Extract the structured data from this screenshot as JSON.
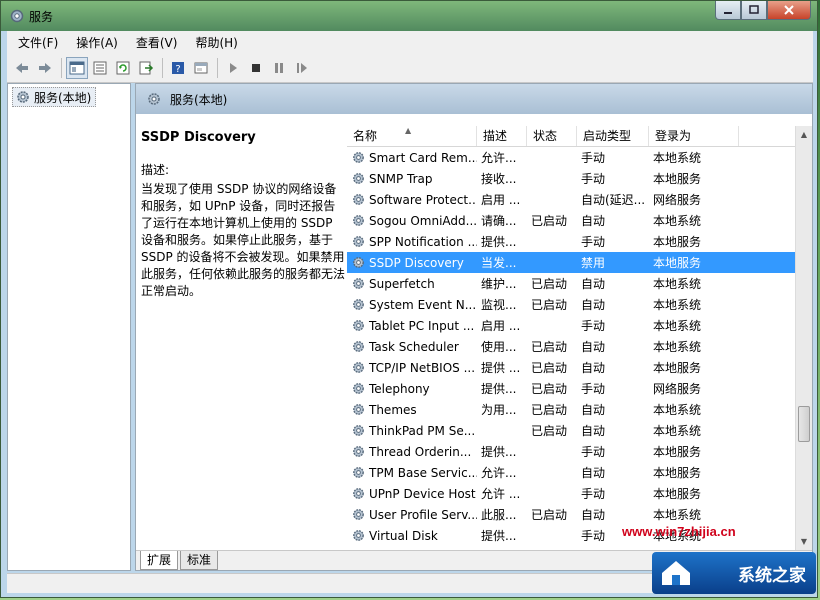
{
  "window": {
    "title": "服务"
  },
  "menu": [
    "文件(F)",
    "操作(A)",
    "查看(V)",
    "帮助(H)"
  ],
  "tree": {
    "root": "服务(本地)"
  },
  "main": {
    "header": "服务(本地)",
    "selected_service": {
      "title": "SSDP Discovery",
      "desc_label": "描述:",
      "desc": "当发现了使用 SSDP 协议的网络设备和服务，如 UPnP 设备，同时还报告了运行在本地计算机上使用的 SSDP 设备和服务。如果停止此服务，基于 SSDP 的设备将不会被发现。如果禁用此服务，任何依赖此服务的服务都无法正常启动。"
    },
    "columns": [
      "名称",
      "描述",
      "状态",
      "启动类型",
      "登录为"
    ],
    "sort_arrow": "▲",
    "rows": [
      {
        "name": "Smart Card Rem...",
        "desc": "允许...",
        "status": "",
        "startup": "手动",
        "logon": "本地系统"
      },
      {
        "name": "SNMP Trap",
        "desc": "接收...",
        "status": "",
        "startup": "手动",
        "logon": "本地服务"
      },
      {
        "name": "Software Protect...",
        "desc": "启用 ...",
        "status": "",
        "startup": "自动(延迟...",
        "logon": "网络服务"
      },
      {
        "name": "Sogou OmniAdd...",
        "desc": "请确...",
        "status": "已启动",
        "startup": "自动",
        "logon": "本地系统"
      },
      {
        "name": "SPP Notification ...",
        "desc": "提供...",
        "status": "",
        "startup": "手动",
        "logon": "本地服务"
      },
      {
        "name": "SSDP Discovery",
        "desc": "当发...",
        "status": "",
        "startup": "禁用",
        "logon": "本地服务",
        "selected": true
      },
      {
        "name": "Superfetch",
        "desc": "维护...",
        "status": "已启动",
        "startup": "自动",
        "logon": "本地系统"
      },
      {
        "name": "System Event N...",
        "desc": "监视...",
        "status": "已启动",
        "startup": "自动",
        "logon": "本地系统"
      },
      {
        "name": "Tablet PC Input ...",
        "desc": "启用 ...",
        "status": "",
        "startup": "手动",
        "logon": "本地系统"
      },
      {
        "name": "Task Scheduler",
        "desc": "使用...",
        "status": "已启动",
        "startup": "自动",
        "logon": "本地系统"
      },
      {
        "name": "TCP/IP NetBIOS ...",
        "desc": "提供 ...",
        "status": "已启动",
        "startup": "自动",
        "logon": "本地服务"
      },
      {
        "name": "Telephony",
        "desc": "提供...",
        "status": "已启动",
        "startup": "手动",
        "logon": "网络服务"
      },
      {
        "name": "Themes",
        "desc": "为用...",
        "status": "已启动",
        "startup": "自动",
        "logon": "本地系统"
      },
      {
        "name": "ThinkPad PM Se...",
        "desc": "",
        "status": "已启动",
        "startup": "自动",
        "logon": "本地系统"
      },
      {
        "name": "Thread Orderin...",
        "desc": "提供...",
        "status": "",
        "startup": "手动",
        "logon": "本地服务"
      },
      {
        "name": "TPM Base Servic...",
        "desc": "允许...",
        "status": "",
        "startup": "自动",
        "logon": "本地服务"
      },
      {
        "name": "UPnP Device Host",
        "desc": "允许 ...",
        "status": "",
        "startup": "手动",
        "logon": "本地服务"
      },
      {
        "name": "User Profile Serv...",
        "desc": "此服...",
        "status": "已启动",
        "startup": "自动",
        "logon": "本地系统"
      },
      {
        "name": "Virtual Disk",
        "desc": "提供...",
        "status": "",
        "startup": "手动",
        "logon": "本地系统"
      }
    ]
  },
  "tabs": [
    "扩展",
    "标准"
  ],
  "watermark": {
    "url": "www.win7zhijia.cn",
    "brand": "系统之家"
  },
  "colors": {
    "selection": "#3399ff",
    "header": "#b8cde0"
  }
}
